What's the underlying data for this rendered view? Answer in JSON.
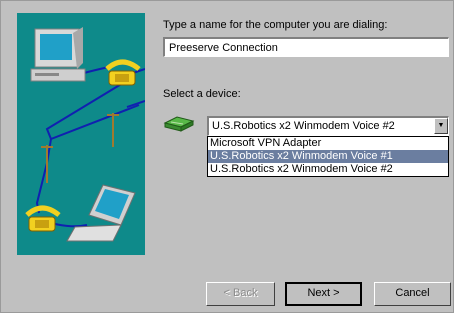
{
  "prompts": {
    "name_label": "Type a name for the computer you are dialing:",
    "device_label": "Select a device:"
  },
  "connection_name": "Preeserve Connection",
  "device": {
    "selected": "U.S.Robotics x2 Winmodem Voice #2",
    "options": [
      "Microsoft VPN Adapter",
      "U.S.Robotics x2 Winmodem Voice #1",
      "U.S.Robotics x2 Winmodem Voice #2"
    ]
  },
  "buttons": {
    "back": "< Back",
    "next": "Next >",
    "cancel": "Cancel"
  },
  "colors": {
    "panel": "#0e8a8a",
    "highlight": "#6b7ea0",
    "face": "#c0c0c0"
  },
  "icons": [
    "computer-icon",
    "telephone-icon",
    "laptop-icon",
    "modem-icon",
    "dropdown-arrow-icon"
  ]
}
